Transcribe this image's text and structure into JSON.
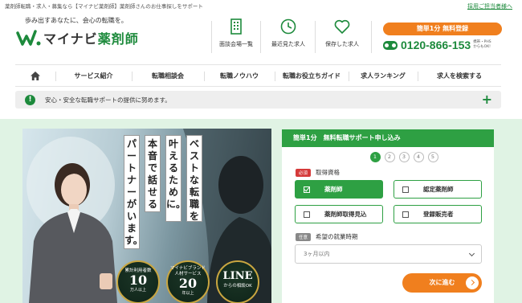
{
  "header": {
    "top_line": "薬剤師転職・求人・募集なら【マイナビ薬剤師】薬剤師さんのお仕事探しをサポート",
    "recruit_link": "採用ご担当者様へ",
    "tagline": "歩み出すあなたに、会心の転職を。",
    "logo_brand": "マイナビ",
    "logo_suffix": "薬剤師",
    "quick_nav": [
      {
        "label": "面談会場一覧",
        "icon": "building-icon"
      },
      {
        "label": "最近見た求人",
        "icon": "clock-icon"
      },
      {
        "label": "保存した求人",
        "icon": "heart-icon"
      }
    ],
    "register_button": "簡単1分 無料登録",
    "phone": "0120-866-153",
    "phone_note": "携帯・PHS からもOK!"
  },
  "nav": {
    "home_icon": "home-icon",
    "items": [
      "サービス紹介",
      "転職相談会",
      "転職ノウハウ",
      "転職お役立ちガイド",
      "求人ランキング",
      "求人を検索する"
    ]
  },
  "notice": {
    "icon": "exclamation-icon",
    "text": "安心・安全な転職サポートの提供に努めます。",
    "expand_icon": "plus-icon"
  },
  "hero": {
    "catch_columns": [
      "ベストな転職を",
      "叶えるために。",
      "本音で話せる",
      "パートナーがいます。"
    ],
    "badges": [
      {
        "caption": "累計利用者数",
        "value": "10",
        "unit": "万人以上"
      },
      {
        "caption": "マイナビブランド 人材サービス",
        "value": "20",
        "unit": "年以上"
      },
      {
        "caption": "からの相談OK",
        "value": "LINE",
        "unit": ""
      }
    ]
  },
  "form": {
    "title": "簡単1分　無料転職サポート申し込み",
    "steps": [
      "1",
      "2",
      "3",
      "4",
      "5"
    ],
    "active_step": 1,
    "qualification": {
      "badge": "必須",
      "label": "取得資格",
      "options": [
        {
          "label": "薬剤師",
          "checked": true
        },
        {
          "label": "認定薬剤師",
          "checked": false
        },
        {
          "label": "薬剤師取得見込",
          "checked": false
        },
        {
          "label": "登録販売者",
          "checked": false
        }
      ]
    },
    "timing": {
      "badge": "任意",
      "label": "希望の就業時期",
      "selected": "3ヶ月以内"
    },
    "next_button": "次に進む"
  },
  "colors": {
    "brand_green": "#1d8a3c",
    "form_green": "#2ea043",
    "accent_orange": "#f07f1e",
    "hero_bg": "#e0f3e4"
  }
}
